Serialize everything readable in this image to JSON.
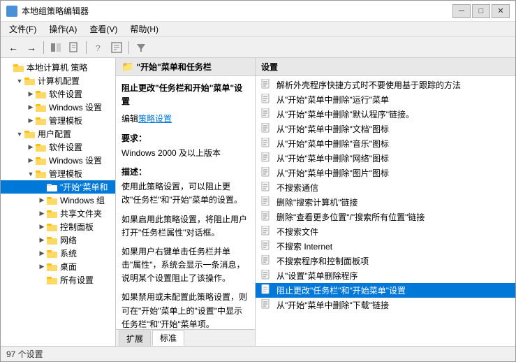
{
  "window": {
    "title": "本地组策略编辑器",
    "icon": "policy-editor-icon"
  },
  "title_buttons": {
    "minimize": "─",
    "restore": "□",
    "close": "✕"
  },
  "menu": {
    "items": [
      {
        "label": "文件(F)"
      },
      {
        "label": "操作(A)"
      },
      {
        "label": "查看(V)"
      },
      {
        "label": "帮助(H)"
      }
    ]
  },
  "toolbar": {
    "buttons": [
      {
        "name": "back",
        "icon": "←"
      },
      {
        "name": "forward",
        "icon": "→"
      },
      {
        "name": "up",
        "icon": "↑"
      },
      {
        "name": "show-hide",
        "icon": "■"
      },
      {
        "name": "help",
        "icon": "?"
      },
      {
        "name": "properties",
        "icon": "▦"
      },
      {
        "name": "filter",
        "icon": "▼"
      }
    ]
  },
  "tree": {
    "header": "本地计算机 策略",
    "items": [
      {
        "id": "local-policy",
        "label": "本地计算机 策略",
        "level": 0,
        "toggle": "",
        "type": "root"
      },
      {
        "id": "computer-config",
        "label": "计算机配置",
        "level": 1,
        "toggle": "▼",
        "type": "folder",
        "expanded": true
      },
      {
        "id": "software-settings",
        "label": "软件设置",
        "level": 2,
        "toggle": "▶",
        "type": "folder"
      },
      {
        "id": "windows-settings",
        "label": "Windows 设置",
        "level": 2,
        "toggle": "▶",
        "type": "folder"
      },
      {
        "id": "admin-templates1",
        "label": "管理模板",
        "level": 2,
        "toggle": "▶",
        "type": "folder"
      },
      {
        "id": "user-config",
        "label": "用户配置",
        "level": 1,
        "toggle": "▼",
        "type": "folder",
        "expanded": true
      },
      {
        "id": "software-settings2",
        "label": "软件设置",
        "level": 2,
        "toggle": "▶",
        "type": "folder"
      },
      {
        "id": "windows-settings2",
        "label": "Windows 设置",
        "level": 2,
        "toggle": "▶",
        "type": "folder"
      },
      {
        "id": "admin-templates2",
        "label": "管理模板",
        "level": 2,
        "toggle": "▼",
        "type": "folder",
        "expanded": true,
        "selected": false
      },
      {
        "id": "start-menu",
        "label": "\"开始\"菜单和",
        "level": 3,
        "toggle": "",
        "type": "folder",
        "selected": true
      },
      {
        "id": "windows-components",
        "label": "Windows 组",
        "level": 3,
        "toggle": "▶",
        "type": "folder"
      },
      {
        "id": "shared-files",
        "label": "共享文件夹",
        "level": 3,
        "toggle": "▶",
        "type": "folder"
      },
      {
        "id": "control-panel",
        "label": "控制面板",
        "level": 3,
        "toggle": "▶",
        "type": "folder"
      },
      {
        "id": "network",
        "label": "网络",
        "level": 3,
        "toggle": "▶",
        "type": "folder"
      },
      {
        "id": "system",
        "label": "系统",
        "level": 3,
        "toggle": "▶",
        "type": "folder"
      },
      {
        "id": "desktop",
        "label": "桌面",
        "level": 3,
        "toggle": "▶",
        "type": "folder"
      },
      {
        "id": "all-settings",
        "label": "所有设置",
        "level": 3,
        "toggle": "",
        "type": "folder"
      }
    ]
  },
  "middle_panel": {
    "header": "\"开始\"菜单和任务栏",
    "header_icon": "folder",
    "title": "阻止更改\"任务栏和开始\"菜单\"设置",
    "link_text": "策略设置",
    "sections": [
      {
        "title": "要求：",
        "content": "Windows 2000 及以上版本"
      },
      {
        "title": "描述：",
        "content": "使用此策略设置，可以阻止更改\"任务栏\"和\"开始\"菜单的设置。"
      },
      {
        "title": "",
        "content": "如果启用此策略设置，将阻止用户打开\"任务栏属性\"对话框。"
      },
      {
        "title": "",
        "content": "如果用户右键单击任务栏并单击\"属性\"，系统会显示一条消息，说明某个设置阻止了该操作。"
      },
      {
        "title": "",
        "content": "如果禁用或未配置此策略设置，则可在\"开始\"菜单上的\"设置\"中显示任务栏\"和\"开始\"菜单项。"
      }
    ],
    "tabs": [
      {
        "label": "扩展",
        "active": false
      },
      {
        "label": "标准",
        "active": true
      }
    ]
  },
  "right_panel": {
    "header": "设置",
    "items": [
      {
        "label": "解析外壳程序快捷方式时不要使用基于跟踪的方法",
        "icon": "doc"
      },
      {
        "label": "从\"开始\"菜单中删除\"运行\"菜单",
        "icon": "doc"
      },
      {
        "label": "从\"开始\"菜单中删除\"默认程序\"链接。",
        "icon": "doc"
      },
      {
        "label": "从\"开始\"菜单中删除\"文档\"图标",
        "icon": "doc"
      },
      {
        "label": "从\"开始\"菜单中删除\"音乐\"图标",
        "icon": "doc"
      },
      {
        "label": "从\"开始\"菜单中删除\"网络\"图标",
        "icon": "doc"
      },
      {
        "label": "从\"开始\"菜单中删除\"图片\"图标",
        "icon": "doc"
      },
      {
        "label": "不搜索通信",
        "icon": "doc"
      },
      {
        "label": "删除\"搜索计算机\"链接",
        "icon": "doc"
      },
      {
        "label": "删除\"查看更多位置\"/\"搜索所有位置\"链接",
        "icon": "doc"
      },
      {
        "label": "不搜索文件",
        "icon": "doc"
      },
      {
        "label": "不搜索 Internet",
        "icon": "doc"
      },
      {
        "label": "不搜索程序和控制面板项",
        "icon": "doc"
      },
      {
        "label": "从\"设置\"菜单删除程序",
        "icon": "doc"
      },
      {
        "label": "阻止更改\"任务栏\"和\"开始菜单\"设置",
        "icon": "doc",
        "selected": true
      },
      {
        "label": "从\"开始\"菜单中删除\"下载\"链接",
        "icon": "doc"
      }
    ]
  },
  "status_bar": {
    "text": "97 个设置"
  },
  "colors": {
    "selection": "#0078d7",
    "hover": "#cce4ff",
    "header_bg": "#e8e8e8",
    "panel_bg": "#fff",
    "toolbar_bg": "#f0f0f0"
  }
}
